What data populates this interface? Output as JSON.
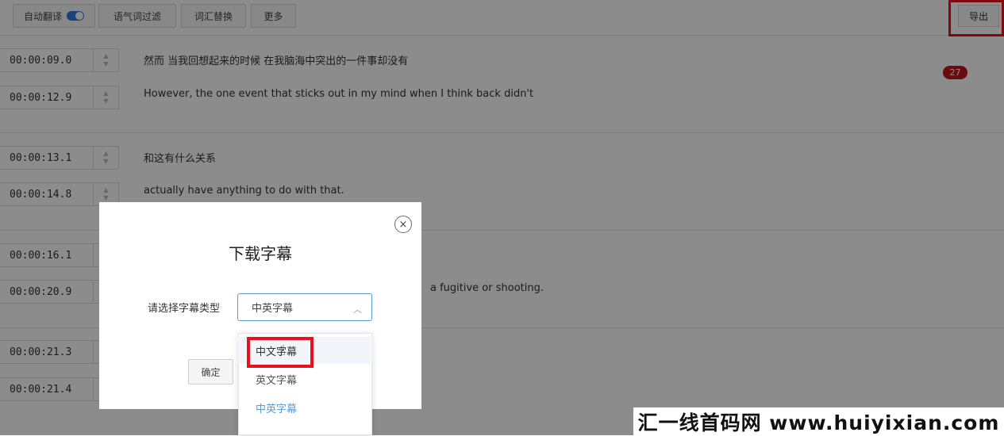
{
  "toolbar": {
    "buttons": [
      "自动翻译",
      "语气词过滤",
      "词汇替换",
      "更多"
    ],
    "export_label": "导出"
  },
  "badge_count": "27",
  "segments": [
    {
      "start": "00:00:09.0",
      "end": "00:00:12.9",
      "zh": "然而 当我回想起来的时候 在我脑海中突出的一件事却没有",
      "en": "However, the one event that sticks out in my mind when I think back didn't"
    },
    {
      "start": "00:00:13.1",
      "end": "00:00:14.8",
      "zh": "和这有什么关系",
      "en": "actually have anything to do with that."
    },
    {
      "start": "00:00:16.1",
      "end": "00:00:20.9",
      "zh": "",
      "en": "a fugitive or shooting."
    },
    {
      "start": "00:00:21.3",
      "end": "00:00:21.4",
      "zh": "",
      "en": ""
    }
  ],
  "dialog": {
    "close_symbol": "×",
    "title": "下载字幕",
    "select_label": "请选择字幕类型",
    "select_value": "中英字幕",
    "confirm_label": "确定",
    "options": [
      "中文字幕",
      "英文字幕",
      "中英字幕"
    ],
    "selected_option_index": 2
  },
  "watermark": "汇一线首码网 www.huiyixian.com",
  "colors": {
    "accent": "#5b9bd5",
    "highlight_red": "#e8111d",
    "badge": "#c0171c",
    "toggle_on": "#2f7de1"
  }
}
